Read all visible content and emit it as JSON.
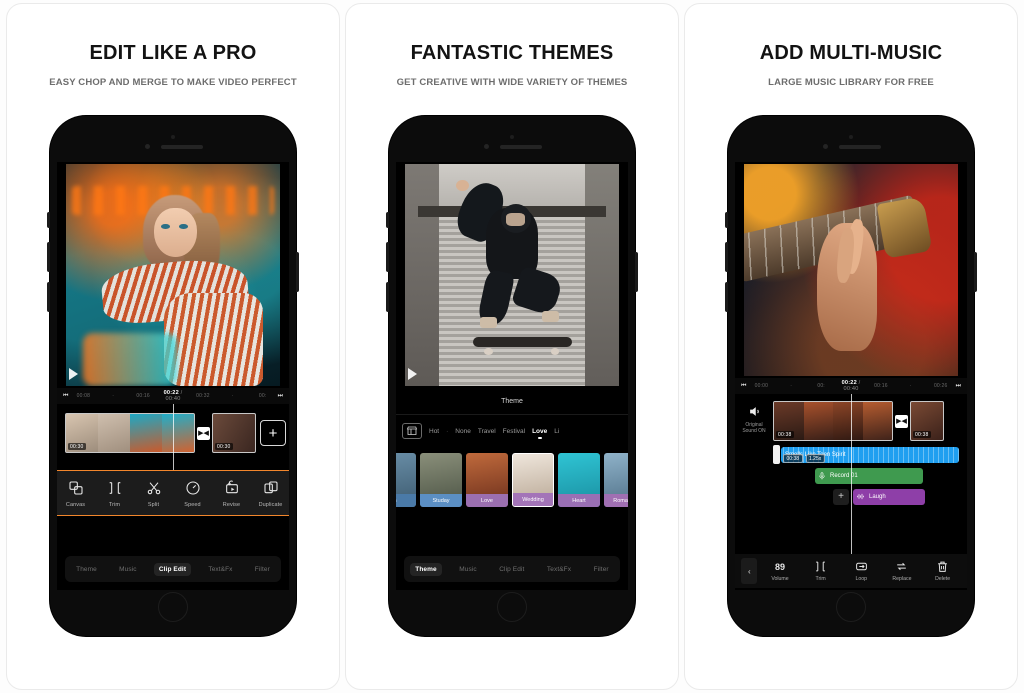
{
  "cards": [
    {
      "headline": "EDIT LIKE A PRO",
      "subhead": "EASY CHOP AND MERGE TO MAKE VIDEO PERFECT",
      "timeline": {
        "ticks": [
          "00:08",
          "·",
          "00:16",
          "",
          "00:32",
          "·",
          "00:"
        ],
        "current": "00:22",
        "total": "/ 00:40",
        "clip_durations": [
          "00:30",
          "00:30"
        ],
        "transition_icon": "transition-icon",
        "add_label": "+"
      },
      "tools": [
        {
          "label": "Canvas",
          "icon": "canvas-icon"
        },
        {
          "label": "Trim",
          "icon": "trim-icon"
        },
        {
          "label": "Split",
          "icon": "scissors-icon"
        },
        {
          "label": "Speed",
          "icon": "speedometer-icon"
        },
        {
          "label": "Revise",
          "icon": "reverse-icon"
        },
        {
          "label": "Duplicate",
          "icon": "duplicate-icon"
        }
      ],
      "tabs": [
        {
          "label": "Theme",
          "active": false
        },
        {
          "label": "Music",
          "active": false
        },
        {
          "label": "Clip Edit",
          "active": true
        },
        {
          "label": "Text&Fx",
          "active": false
        },
        {
          "label": "Filter",
          "active": false
        }
      ]
    },
    {
      "headline": "FANTASTIC THEMES",
      "subhead": "GET CREATIVE WITH WIDE VARIETY OF THEMES",
      "panel_title": "Theme",
      "category_icon": "store-icon",
      "categories": [
        {
          "label": "Hot",
          "active": false
        },
        {
          "label": "·",
          "active": false
        },
        {
          "label": "None",
          "active": false
        },
        {
          "label": "Travel",
          "active": false
        },
        {
          "label": "Festival",
          "active": false
        },
        {
          "label": "Love",
          "active": true
        },
        {
          "label": "Li",
          "active": false
        }
      ],
      "themes": [
        {
          "name": "n",
          "color": "#3f6fa8",
          "selected": false
        },
        {
          "name": "Studay",
          "color": "#5b8fc4",
          "selected": false
        },
        {
          "name": "Love",
          "color": "#9b6fb0",
          "selected": false
        },
        {
          "name": "Wedding",
          "color": "#a374b8",
          "selected": true
        },
        {
          "name": "Heart",
          "color": "#9a6fb4",
          "selected": false
        },
        {
          "name": "Romance",
          "color": "#a06fb2",
          "selected": false
        },
        {
          "name": "",
          "color": "#7a5c9e",
          "selected": false
        }
      ],
      "tabs": [
        {
          "label": "Theme",
          "active": true
        },
        {
          "label": "Music",
          "active": false
        },
        {
          "label": "Clip Edit",
          "active": false
        },
        {
          "label": "Text&Fx",
          "active": false
        },
        {
          "label": "Filter",
          "active": false
        }
      ]
    },
    {
      "headline": "ADD MULTI-MUSIC",
      "subhead": "LARGE MUSIC LIBRARY FOR FREE",
      "timeline": {
        "ticks": [
          "00:00",
          "·",
          "00:",
          "00:16",
          "·",
          "00:26"
        ],
        "current": "00:22",
        "total": "/ 00:40",
        "clip_durations": [
          "00:38",
          "00:38"
        ]
      },
      "sound_toggle": {
        "icon": "speaker-icon",
        "label_line1": "Original",
        "label_line2": "Sound ON"
      },
      "audio_tracks": [
        {
          "title": "Smells Like Teen Spirit",
          "color": "#1f9ff0",
          "duration": "00:38",
          "speed": "1.25x",
          "icon": "music-note-icon"
        },
        {
          "title": "Record 01",
          "color": "#3f9a4f",
          "icon": "microphone-icon"
        },
        {
          "title": "Laugh",
          "color": "#8e3fa8",
          "icon": "waveform-icon"
        }
      ],
      "add_track_label": "+",
      "audio_tools": [
        {
          "label": "Volume",
          "value": "89",
          "icon": "volume-value-icon"
        },
        {
          "label": "Trim",
          "value": "",
          "icon": "trim-icon"
        },
        {
          "label": "Loop",
          "value": "",
          "icon": "loop-icon"
        },
        {
          "label": "Replace",
          "value": "",
          "icon": "replace-icon"
        },
        {
          "label": "Delete",
          "value": "",
          "icon": "trash-icon"
        }
      ],
      "back_label": "‹"
    }
  ],
  "colors": {
    "accent_orange": "#f2862c",
    "audio_blue": "#1f9ff0",
    "audio_green": "#3f9a4f",
    "audio_purple": "#8e3fa8",
    "card_border": "#eaeaea"
  }
}
